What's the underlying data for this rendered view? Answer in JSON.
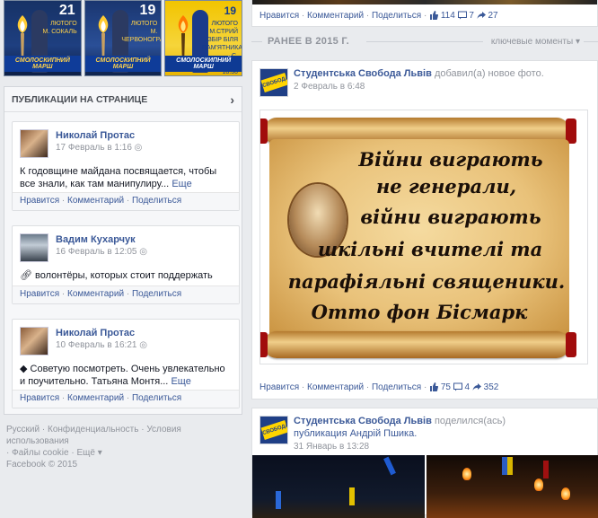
{
  "banners": [
    {
      "date": "21",
      "month": "ЛЮТОГО",
      "text": "М. СОКАЛЬ",
      "caption": "СМОЛОСКИПНИЙ МАРШ"
    },
    {
      "date": "19",
      "month": "ЛЮТОГО",
      "text": "М. ЧЕРВОНОГРАД",
      "caption": "СМОЛОСКИПНИЙ МАРШ"
    },
    {
      "date": "19",
      "month": "ЛЮТОГО М.СТРИЙ",
      "text": "ЗБІР БІЛЯ ПАМ'ЯТНИКА С. БАНДЕРИ 18:30",
      "caption": "СМОЛОСКИПНИЙ МАРШ"
    }
  ],
  "pages_panel": {
    "title": "ПУБЛИКАЦИИ НА СТРАНИЦЕ",
    "posts": [
      {
        "author": "Николай Протас",
        "time": "17 Февраль в 1:16",
        "text": "К годовщине майдана посвящается, чтобы все знали, как там манипулиру...",
        "more": "Еще",
        "actions": [
          "Нравится",
          "Комментарий",
          "Поделиться"
        ]
      },
      {
        "author": "Вадим Кухарчук",
        "time": "16 Февраль в 12:05",
        "text": "волонтёры, которых стоит поддержать",
        "more": "",
        "actions": [
          "Нравится",
          "Комментарий",
          "Поделиться"
        ]
      },
      {
        "author": "Николай Протас",
        "time": "10 Февраль в 16:21",
        "text": "Советую посмотреть. Очень увлекательно и поучительно. Татьяна Монтя...",
        "more": "Еще",
        "actions": [
          "Нравится",
          "Комментарий",
          "Поделиться"
        ]
      }
    ]
  },
  "footer": {
    "line1": "Русский · Конфиденциальность · Условия использования",
    "line2": "· Файлы cookie · Ещё ▾",
    "line3": "Facebook © 2015"
  },
  "top_post_actions": {
    "like": "Нравится",
    "comment": "Комментарий",
    "share": "Поделиться",
    "likes": "114",
    "comments": "7",
    "shares": "27"
  },
  "earlier": {
    "title": "РАНЕЕ В 2015 Г.",
    "moments": "ключевые моменты ▾"
  },
  "post1": {
    "author": "Студентська Свобода Львів",
    "verb": "добавил(а) новое фото.",
    "time": "2 Февраль в 6:48",
    "quote_lines": [
      "Війни виграють",
      "не генерали,",
      "війни виграють",
      "шкільні вчителі та",
      "парафіяльні священики.",
      "Отто фон Бісмарк"
    ],
    "like": "Нравится",
    "comment": "Комментарий",
    "share": "Поделиться",
    "likes": "75",
    "comments": "4",
    "shares": "352"
  },
  "post2": {
    "author": "Студентська Свобода Львів",
    "verb": "поделился(ась)",
    "shared": "публикация Андрій Пшика.",
    "time": "31 Январь в 13:28"
  },
  "colors": {
    "link": "#3b5998",
    "muted": "#90949c",
    "bg": "#e9ebee"
  }
}
